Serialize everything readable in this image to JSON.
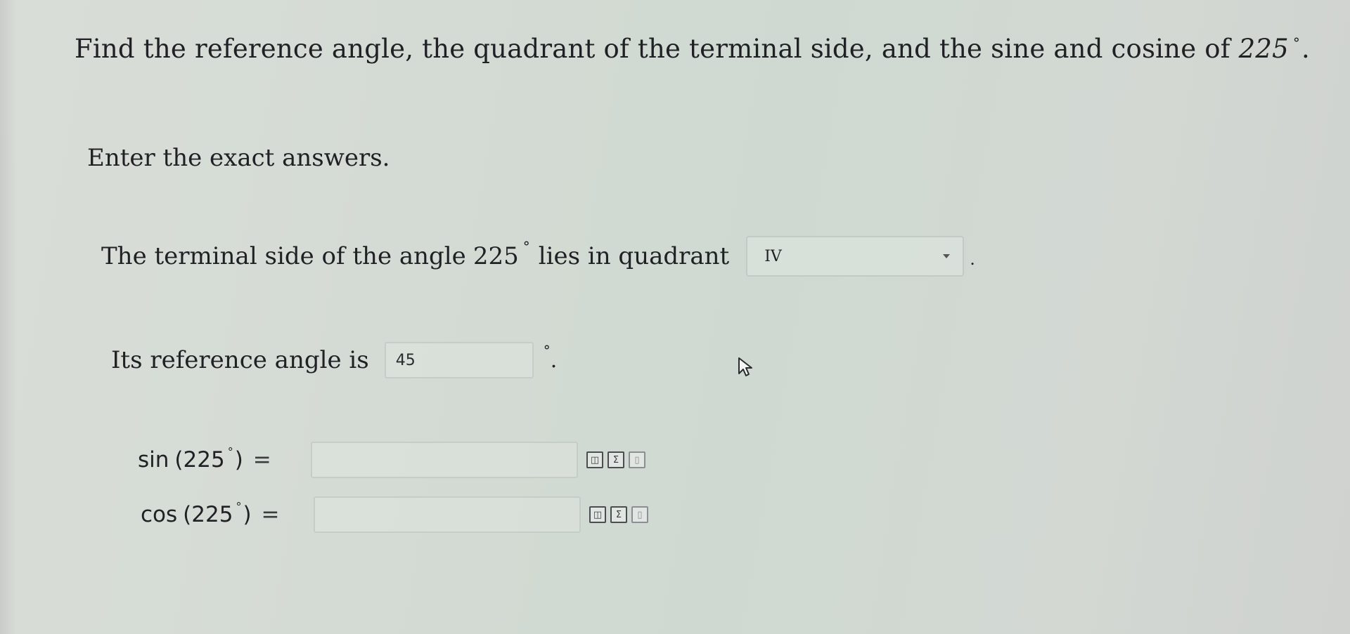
{
  "question": {
    "prompt_before": "Find the reference angle, the quadrant of the terminal side, and the sine and cosine of",
    "angle": "225",
    "degree_symbol": "°",
    "period": "."
  },
  "instructions": "Enter the exact answers.",
  "quadrant_row": {
    "text_before": "The terminal side of the angle",
    "angle": "225",
    "degree_symbol": "°",
    "text_after": "lies in quadrant",
    "selected_value": "IV",
    "trailing": "."
  },
  "reference_row": {
    "label": "Its reference angle is",
    "value": "45",
    "degree_symbol": "°",
    "trailing": "."
  },
  "sin_row": {
    "func": "sin",
    "open": "(225",
    "degree_symbol": "°",
    "close": ")",
    "equals": "=",
    "value": ""
  },
  "cos_row": {
    "func": "cos",
    "open": "(225",
    "degree_symbol": "°",
    "close": ")",
    "equals": "=",
    "value": ""
  },
  "tool_icons": [
    "graph-tool-icon",
    "equation-editor-icon",
    "help-document-icon"
  ]
}
